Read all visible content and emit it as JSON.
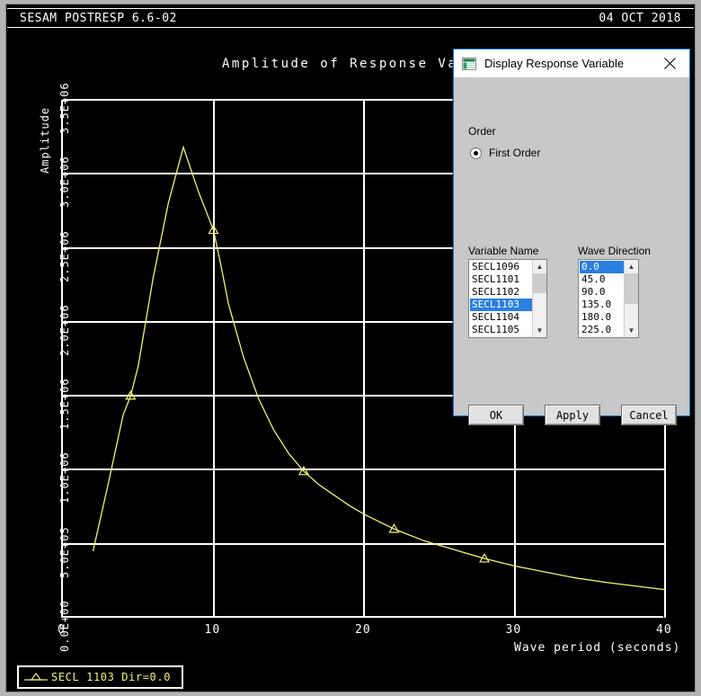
{
  "app": {
    "title": "SESAM POSTRESP 6.6-02",
    "date": "04 OCT 2018"
  },
  "chart_data": {
    "type": "line",
    "title": "Amplitude of Response Vario",
    "xlabel": "Wave period (seconds)",
    "ylabel": "Amplitude",
    "xlim": [
      0,
      40
    ],
    "ylim": [
      0,
      3500000
    ],
    "xticks": [
      "0",
      "10",
      "20",
      "30",
      "40"
    ],
    "xtick_values": [
      0,
      10,
      20,
      30,
      40
    ],
    "yticks": [
      "0.0E+00",
      "5.0E+05",
      "1.0E+06",
      "1.5E+06",
      "2.0E+06",
      "2.5E+06",
      "3.0E+06",
      "3.5E+06"
    ],
    "ytick_values": [
      0,
      500000,
      1000000,
      1500000,
      2000000,
      2500000,
      3000000,
      3500000
    ],
    "grid": true,
    "legend_position": "bottom-left",
    "series": [
      {
        "name": "SECL 1103  Dir=0.0",
        "color": "#f2f274",
        "marker": "triangle",
        "x": [
          2.0,
          3.0,
          4.0,
          4.5,
          5.0,
          6.0,
          7.0,
          8.0,
          8.5,
          9.0,
          10.0,
          10.5,
          11.0,
          12.0,
          13.0,
          14.0,
          15.0,
          16.0,
          17.0,
          18.0,
          19.0,
          20.0,
          21.0,
          22.0,
          23.0,
          24.0,
          25.0,
          26.0,
          28.0,
          30.0,
          32.0,
          34.0,
          36.0,
          38.0,
          40.0
        ],
        "y": [
          450000,
          900000,
          1370000,
          1500000,
          1700000,
          2300000,
          2800000,
          3180000,
          3030000,
          2880000,
          2620000,
          2380000,
          2120000,
          1760000,
          1480000,
          1270000,
          1110000,
          990000,
          900000,
          830000,
          760000,
          700000,
          650000,
          600000,
          560000,
          520000,
          490000,
          460000,
          400000,
          350000,
          310000,
          270000,
          240000,
          215000,
          190000
        ],
        "marker_x": [
          4.5,
          10.0,
          16.0,
          22.0,
          28.0
        ],
        "marker_y": [
          1500000,
          2620000,
          990000,
          600000,
          400000
        ]
      }
    ]
  },
  "dialog": {
    "title": "Display Response Variable",
    "icon": "window-icon",
    "close_icon": "close-icon",
    "order": {
      "group_label": "Order",
      "option_label": "First Order",
      "selected": true
    },
    "variable_name": {
      "label": "Variable Name",
      "items": [
        "SECL1096",
        "SECL1101",
        "SECL1102",
        "SECL1103",
        "SECL1104",
        "SECL1105"
      ],
      "selected": "SECL1103"
    },
    "wave_direction": {
      "label": "Wave Direction",
      "items": [
        "0.0",
        "45.0",
        "90.0",
        "135.0",
        "180.0",
        "225.0"
      ],
      "selected": "0.0"
    },
    "buttons": {
      "ok": "OK",
      "apply": "Apply",
      "cancel": "Cancel"
    }
  },
  "colors": {
    "curve": "#f2f274",
    "plot_bg": "#000000",
    "axis": "#ffffff",
    "selection": "#2a7fe0",
    "dialog_border": "#0078d7"
  }
}
